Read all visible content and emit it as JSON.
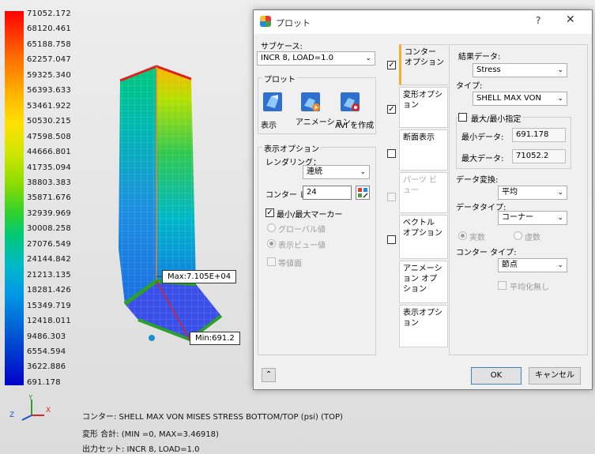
{
  "legend": {
    "values": [
      "71052.172",
      "68120.461",
      "65188.758",
      "62257.047",
      "59325.340",
      "56393.633",
      "53461.922",
      "50530.215",
      "47598.508",
      "44666.801",
      "41735.094",
      "38803.383",
      "35871.676",
      "32939.969",
      "30008.258",
      "27076.549",
      "24144.842",
      "21213.135",
      "18281.426",
      "15349.719",
      "12418.011",
      "9486.303",
      "6554.594",
      "3622.886",
      "691.178"
    ]
  },
  "model": {
    "max_label": "Max:7.105E+04",
    "min_label": "Min:691.2"
  },
  "status": {
    "line1": "コンター: SHELL MAX VON MISES STRESS BOTTOM/TOP (psi) (TOP)",
    "line2": "変形 合計: (MIN        =0, MAX=3.46918)",
    "line3": "出力セット: INCR 8, LOAD=1.0"
  },
  "axis": {
    "x": "X",
    "y": "Y",
    "z": "Z"
  },
  "dialog": {
    "title": "プロット",
    "help": "?",
    "close": "✕",
    "subcase_label": "サブケース:",
    "subcase_value": "INCR 8, LOAD=1.0",
    "plot_group": "プロット",
    "plot_buttons": [
      {
        "label": "表示",
        "icon": "display-icon"
      },
      {
        "label": "アニメーション",
        "icon": "animation-icon"
      },
      {
        "label": "AVI を作成",
        "icon": "avi-icon"
      }
    ],
    "display_group": "表示オプション",
    "rendering_label": "レンダリング：",
    "rendering_value": "連続",
    "contour_label": "コンター レ",
    "contour_value": "24",
    "minmax_marker": "最小/最大マーカー",
    "global_value": "グローバル値",
    "view_value": "表示ビュー値",
    "iso_surface": "等値面",
    "tabs": [
      {
        "label": "コンター オプション",
        "checked": true,
        "active": true
      },
      {
        "label": "変形オプション",
        "checked": true
      },
      {
        "label": "断面表示",
        "checked": false
      },
      {
        "label": "パーツ ビュー",
        "checked": false,
        "disabled": true
      },
      {
        "label": "ベクトル オプション",
        "checked": false
      },
      {
        "label": "アニメーション オプション"
      },
      {
        "label": "表示オプション"
      }
    ],
    "result_label": "結果データ:",
    "result_value": "Stress",
    "type_label": "タイプ:",
    "type_value": "SHELL MAX VON MISES",
    "minmax_spec": "最大/最小指定",
    "min_data_label": "最小データ:",
    "min_data_value": "691.178",
    "max_data_label": "最大データ:",
    "max_data_value": "71052.2",
    "transform_label": "データ変換:",
    "transform_value": "平均",
    "datatype_label": "データタイプ:",
    "datatype_value": "コーナー",
    "real": "実数",
    "imag": "虚数",
    "contour_type_label": "コンター タイプ:",
    "contour_type_value": "節点",
    "no_average": "平均化無し",
    "collapse": "⌃",
    "ok": "OK",
    "cancel": "キャンセル"
  }
}
